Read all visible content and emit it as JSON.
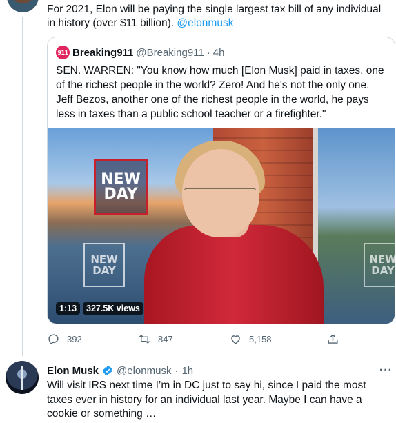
{
  "main_tweet": {
    "text": "For 2021, Elon will be paying the single largest tax bill of any individual in history (over $11 billion).",
    "mention": "@elonmusk"
  },
  "quote": {
    "avatar_text": "911",
    "author_name": "Breaking911",
    "author_handle": "@Breaking911",
    "separator": "·",
    "time": "4h",
    "text": "SEN. WARREN: \"You know how much [Elon Musk] paid in taxes, one of the richest people in the world? Zero! And he's not the only one. Jeff Bezos, another one of the richest people in the world, he pays less in taxes than a public school teacher or a firefighter.\"",
    "video": {
      "duration": "1:13",
      "views": "327.5K views",
      "show_logo_line1": "NEW",
      "show_logo_line2": "DAY"
    }
  },
  "actions": {
    "replies": "392",
    "retweets": "847",
    "likes": "5,158"
  },
  "reply_tweet": {
    "author_name": "Elon Musk",
    "author_handle": "@elonmusk",
    "separator": "·",
    "time": "1h",
    "more": "···",
    "text": "Will visit IRS next time I’m in DC just to say hi, since I paid the most taxes ever in history for an individual last year. Maybe I can have a cookie or something …"
  },
  "colors": {
    "accent": "#1d9bf0",
    "text": "#0f1419",
    "muted": "#536471",
    "border": "#cfd9de"
  }
}
